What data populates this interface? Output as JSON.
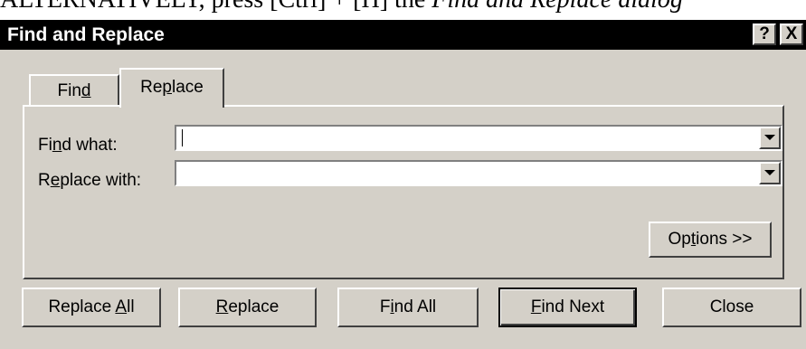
{
  "top_strip": {
    "text_plain": "ALTERNATIVELY, press [Ctrl] + [H] the ",
    "text_italic": "Find and Replace dialog"
  },
  "window": {
    "title": "Find and Replace",
    "help_label": "?",
    "close_label": "X"
  },
  "tabs": [
    {
      "pre": "Fin",
      "accel": "d",
      "post": ""
    },
    {
      "pre": "Re",
      "accel": "p",
      "post": "lace"
    }
  ],
  "fields": {
    "find_what": {
      "pre": "Fi",
      "accel": "n",
      "post": "d what:",
      "value": "",
      "placeholder": ""
    },
    "replace_with": {
      "pre": "R",
      "accel": "e",
      "post": "place with:",
      "value": "",
      "placeholder": ""
    }
  },
  "buttons": {
    "options": {
      "pre": "Op",
      "accel": "t",
      "post": "ions >>"
    },
    "replace_all": {
      "pre": "Replace ",
      "accel": "A",
      "post": "ll"
    },
    "replace": {
      "pre": "",
      "accel": "R",
      "post": "eplace"
    },
    "find_all": {
      "pre": "F",
      "accel": "i",
      "post": "nd All"
    },
    "find_next": {
      "pre": "",
      "accel": "F",
      "post": "ind Next"
    },
    "close": {
      "pre": "Close",
      "accel": "",
      "post": ""
    }
  },
  "colors": {
    "titlebar": "#000000",
    "face": "#d4d0c8",
    "highlight": "#ffffff",
    "shadow": "#404040"
  },
  "icons": {
    "dropdown": "chevron-down-icon",
    "help": "question-mark-icon",
    "close": "close-icon"
  }
}
